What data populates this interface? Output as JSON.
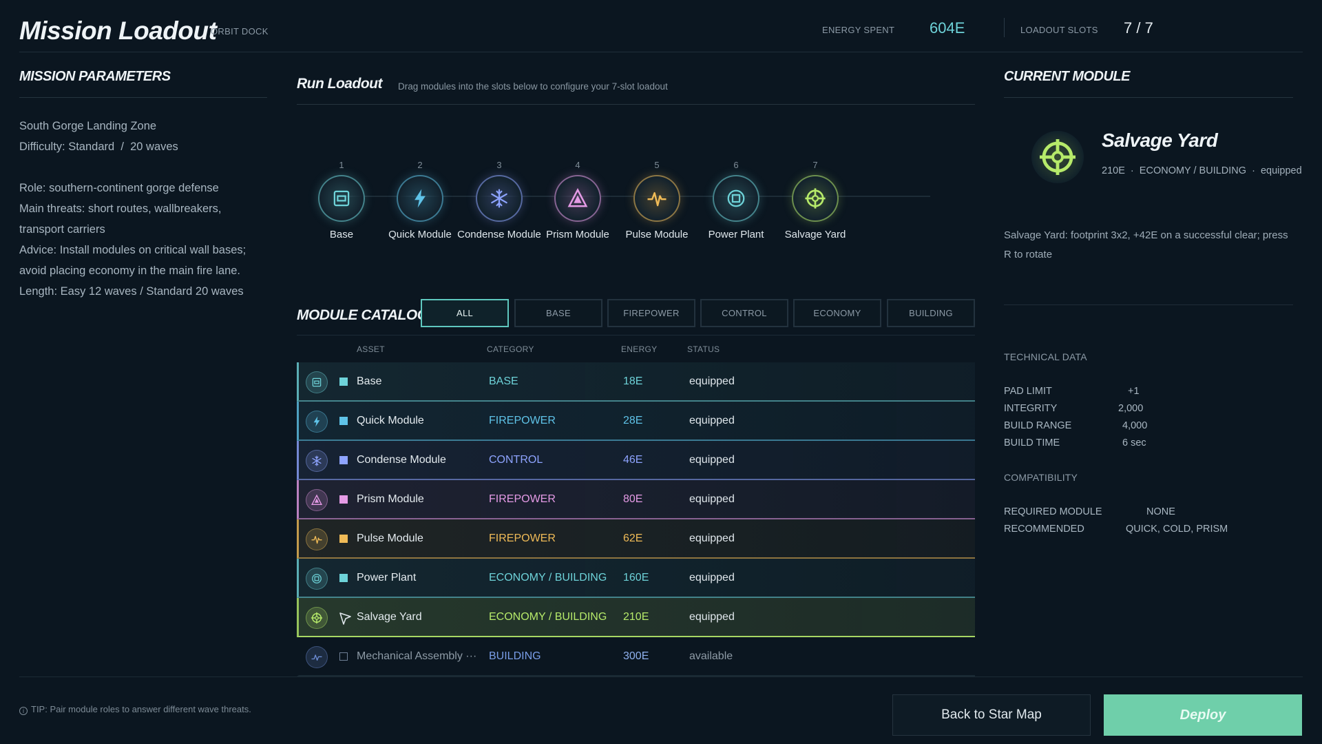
{
  "header": {
    "title": "Mission Loadout",
    "location": "ORBIT DOCK",
    "energy_label": "ENERGY SPENT",
    "energy_value": "604E",
    "slots_label": "LOADOUT SLOTS",
    "slots_value": "7 / 7"
  },
  "mission": {
    "title": "MISSION PARAMETERS",
    "zone": "South Gorge Landing Zone",
    "difficulty": "Difficulty: Standard  /  20 waves",
    "role": "Role: southern-continent gorge defense",
    "threats_1": "Main threats: short routes, wallbreakers,",
    "threats_2": "transport carriers",
    "advice_1": "Advice: Install modules on critical wall bases;",
    "advice_2": "avoid placing economy in the main fire lane.",
    "length": "Length: Easy 12 waves / Standard 20 waves"
  },
  "loadout": {
    "title": "Run Loadout",
    "hint": "Drag modules into the slots below to configure your 7-slot loadout",
    "slots": [
      {
        "num": "1",
        "label": "Base",
        "icon": "base-icon",
        "color": "#6ed3d9"
      },
      {
        "num": "2",
        "label": "Quick Module",
        "icon": "bolt-icon",
        "color": "#5fc3e8"
      },
      {
        "num": "3",
        "label": "Condense Module",
        "icon": "snowflake-icon",
        "color": "#8ea4ff"
      },
      {
        "num": "4",
        "label": "Prism Module",
        "icon": "prism-icon",
        "color": "#e59be6"
      },
      {
        "num": "5",
        "label": "Pulse Module",
        "icon": "pulse-icon",
        "color": "#f0bb57"
      },
      {
        "num": "6",
        "label": "Power Plant",
        "icon": "power-plant-icon",
        "color": "#6ed3d9"
      },
      {
        "num": "7",
        "label": "Salvage Yard",
        "icon": "crosshair-icon",
        "color": "#b6ea6a"
      }
    ]
  },
  "catalog": {
    "title": "MODULE CATALOG",
    "filters": [
      "ALL",
      "BASE",
      "FIREPOWER",
      "CONTROL",
      "ECONOMY",
      "BUILDING"
    ],
    "headers": {
      "asset": "ASSET",
      "category": "CATEGORY",
      "energy": "ENERGY",
      "status": "STATUS"
    },
    "rows": [
      {
        "name": "Base",
        "category": "BASE",
        "energy": "18E",
        "status": "equipped",
        "color": "#6ed3d9",
        "icon": "base-icon"
      },
      {
        "name": "Quick Module",
        "category": "FIREPOWER",
        "energy": "28E",
        "status": "equipped",
        "color": "#5fc3e8",
        "icon": "bolt-icon"
      },
      {
        "name": "Condense Module",
        "category": "CONTROL",
        "energy": "46E",
        "status": "equipped",
        "color": "#8ea4ff",
        "icon": "snowflake-icon"
      },
      {
        "name": "Prism Module",
        "category": "FIREPOWER",
        "energy": "80E",
        "status": "equipped",
        "color": "#e59be6",
        "icon": "prism-icon"
      },
      {
        "name": "Pulse Module",
        "category": "FIREPOWER",
        "energy": "62E",
        "status": "equipped",
        "color": "#f0bb57",
        "icon": "pulse-icon"
      },
      {
        "name": "Power Plant",
        "category": "ECONOMY / BUILDING",
        "energy": "160E",
        "status": "equipped",
        "color": "#6ed3d9",
        "icon": "power-plant-icon"
      },
      {
        "name": "Salvage Yard",
        "category": "ECONOMY / BUILDING",
        "energy": "210E",
        "status": "equipped",
        "color": "#b6ea6a",
        "icon": "crosshair-icon"
      },
      {
        "name": "Mechanical Assembly ···",
        "category": "BUILDING",
        "energy": "300E",
        "status": "available",
        "color": "#6f8fd8",
        "icon": "assembly-icon"
      }
    ]
  },
  "current": {
    "title": "CURRENT MODULE",
    "name": "Salvage Yard",
    "meta": "210E  ·  ECONOMY / BUILDING  ·  equipped",
    "desc": "Salvage Yard: footprint 3x2, +42E on a successful clear; press R to rotate",
    "tech_title": "TECHNICAL DATA",
    "tech": [
      {
        "k": "PAD LIMIT",
        "v": "+1"
      },
      {
        "k": "INTEGRITY",
        "v": "2,000"
      },
      {
        "k": "BUILD RANGE",
        "v": "4,000"
      },
      {
        "k": "BUILD TIME",
        "v": "6 sec"
      }
    ],
    "compat_title": "COMPATIBILITY",
    "compat": [
      {
        "k": "REQUIRED MODULE",
        "v": "NONE"
      },
      {
        "k": "RECOMMENDED",
        "v": "QUICK, COLD, PRISM"
      }
    ]
  },
  "footer": {
    "tip": "TIP: Pair module roles to answer different wave threats.",
    "back_label": "Back to Star Map",
    "deploy_label": "Deploy"
  },
  "colors": {
    "accent": "#6fcfaa",
    "energy": "#6ed3d9"
  }
}
